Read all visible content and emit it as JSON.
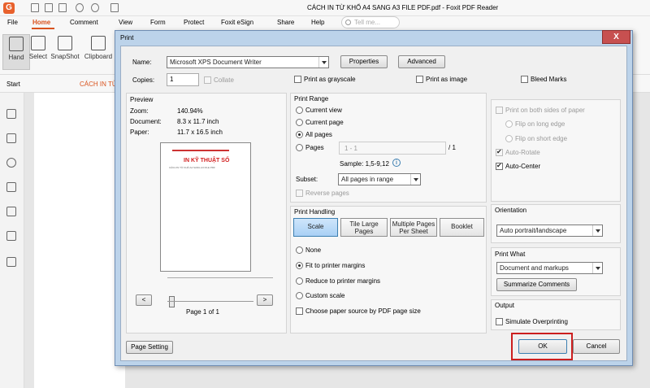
{
  "app": {
    "window_title": "CÁCH IN TỪ KHỔ A4 SANG A3 FILE PDF.pdf - Foxit PDF Reader",
    "logo_letter": "G",
    "menu": [
      "File",
      "Home",
      "Comment",
      "View",
      "Form",
      "Protect",
      "Foxit eSign",
      "Share",
      "Help"
    ],
    "tell_me_placeholder": "Tell me...",
    "ribbon": [
      "Hand",
      "Select",
      "SnapShot",
      "Clipboard"
    ],
    "tabs": [
      "Start",
      "CÁCH IN TỪ"
    ]
  },
  "dialog": {
    "title": "Print",
    "close": "X",
    "name_label": "Name:",
    "printer": "Microsoft XPS Document Writer",
    "properties": "Properties",
    "advanced": "Advanced",
    "copies_label": "Copies:",
    "copies_value": "1",
    "collate": "Collate",
    "print_grayscale": "Print as grayscale",
    "print_image": "Print as image",
    "bleed_marks": "Bleed Marks",
    "preview": {
      "title": "Preview",
      "zoom_label": "Zoom:",
      "zoom_value": "140.94%",
      "document_label": "Document:",
      "document_value": "8.3 x 11.7 inch",
      "paper_label": "Paper:",
      "paper_value": "11.7 x 16.5 inch",
      "page_text": "Page 1 of 1",
      "prev": "<",
      "next": ">",
      "thumb_heading": "IN KỸ THUẬT SỐ",
      "thumb_caption": "CÁCH IN TỪ KHỔ A4 SANG A3 FILE PDF"
    },
    "print_range": {
      "title": "Print Range",
      "current_view": "Current view",
      "current_page": "Current page",
      "all_pages": "All pages",
      "pages": "Pages",
      "pages_value": "1 - 1",
      "pages_total": "/ 1",
      "sample": "Sample: 1,5-9,12",
      "info_icon": "i",
      "subset_label": "Subset:",
      "subset_value": "All pages in range",
      "reverse": "Reverse pages"
    },
    "print_handling": {
      "title": "Print Handling",
      "scale": "Scale",
      "tile": "Tile Large Pages",
      "multiple": "Multiple Pages Per Sheet",
      "booklet": "Booklet",
      "none": "None",
      "fit": "Fit to printer margins",
      "reduce": "Reduce to printer margins",
      "custom": "Custom scale",
      "choose_source": "Choose paper source by PDF page size"
    },
    "duplex": {
      "both_sides": "Print on both sides of paper",
      "long_edge": "Flip on long edge",
      "short_edge": "Flip on short edge",
      "auto_rotate": "Auto-Rotate",
      "auto_center": "Auto-Center"
    },
    "orientation": {
      "title": "Orientation",
      "value": "Auto portrait/landscape"
    },
    "print_what": {
      "title": "Print What",
      "value": "Document and markups",
      "summarize": "Summarize Comments"
    },
    "output": {
      "title": "Output",
      "simulate": "Simulate Overprinting"
    },
    "page_setting": "Page Setting",
    "ok": "OK",
    "cancel": "Cancel"
  }
}
